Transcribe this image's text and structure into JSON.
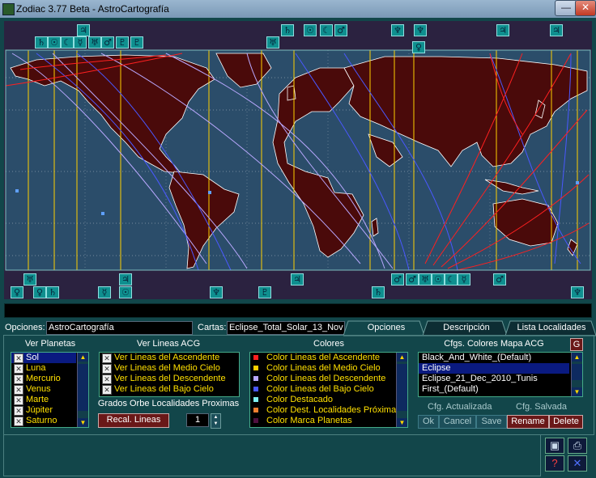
{
  "window": {
    "title": "Zodiac 3.77 Beta - AstroCartografía",
    "minimize_label": "—",
    "close_label": "✕"
  },
  "colors": {
    "asc": "#ff2020",
    "mc": "#ffd000",
    "desc": "#b9a8ff",
    "ic": "#4a58ff",
    "land": "#4a0a0a",
    "sea": "#2b4d6a"
  },
  "top_glyphs": [
    {
      "g": "♃",
      "icon": "jupiter-glyph-icon"
    },
    {
      "g": "♄",
      "icon": "saturn-glyph-icon"
    },
    {
      "g": "☉",
      "icon": "sun-glyph-icon"
    },
    {
      "g": "☾",
      "icon": "moon-glyph-icon"
    },
    {
      "g": "☿",
      "icon": "mercury-glyph-icon"
    },
    {
      "g": "♅",
      "icon": "uranus-glyph-icon"
    },
    {
      "g": "♂",
      "icon": "mars-glyph-icon"
    },
    {
      "g": "♇",
      "icon": "pluto-glyph-icon"
    },
    {
      "g": "♇",
      "icon": "pluto-glyph-icon"
    },
    {
      "g": "♅",
      "icon": "uranus-glyph-icon"
    },
    {
      "g": "♀",
      "icon": "venus-glyph-icon"
    },
    {
      "g": "♄",
      "icon": "saturn-glyph-icon"
    },
    {
      "g": "☉",
      "icon": "sun-glyph-icon"
    },
    {
      "g": "☾",
      "icon": "moon-glyph-icon"
    },
    {
      "g": "♂",
      "icon": "mars-glyph-icon"
    },
    {
      "g": "♆",
      "icon": "neptune-glyph-icon"
    },
    {
      "g": "♆",
      "icon": "neptune-glyph-icon"
    },
    {
      "g": "♃",
      "icon": "jupiter-glyph-icon"
    }
  ],
  "bottom_glyphs": [
    {
      "g": "♅",
      "icon": "uranus-glyph-icon"
    },
    {
      "g": "♃",
      "icon": "jupiter-glyph-icon"
    },
    {
      "g": "♃",
      "icon": "jupiter-glyph-icon"
    },
    {
      "g": "♀",
      "icon": "venus-glyph-icon"
    },
    {
      "g": "♀",
      "icon": "venus-glyph-icon"
    },
    {
      "g": "♄",
      "icon": "saturn-glyph-icon"
    },
    {
      "g": "☿",
      "icon": "mercury-glyph-icon"
    },
    {
      "g": "☉",
      "icon": "sun-glyph-icon"
    },
    {
      "g": "♂",
      "icon": "mars-glyph-icon"
    },
    {
      "g": "♂",
      "icon": "mars-glyph-icon"
    },
    {
      "g": "♅",
      "icon": "uranus-glyph-icon"
    },
    {
      "g": "☉",
      "icon": "sun-glyph-icon"
    },
    {
      "g": "☾",
      "icon": "moon-glyph-icon"
    },
    {
      "g": "☿",
      "icon": "mercury-glyph-icon"
    },
    {
      "g": "♂",
      "icon": "mars-glyph-icon"
    },
    {
      "g": "♆",
      "icon": "neptune-glyph-icon"
    },
    {
      "g": "♇",
      "icon": "pluto-glyph-icon"
    },
    {
      "g": "♄",
      "icon": "saturn-glyph-icon"
    },
    {
      "g": "♆",
      "icon": "neptune-glyph-icon"
    },
    {
      "g": "♃",
      "icon": "jupiter-glyph-icon"
    },
    {
      "g": "♀",
      "icon": "venus-glyph-icon"
    }
  ],
  "fields": {
    "opciones_label": "Opciones:",
    "opciones_value": "AstroCartografía",
    "cartas_label": "Cartas:",
    "cartas_value": "Eclipse_Total_Solar_13_Nov"
  },
  "tabs": [
    {
      "label": "Opciones",
      "active": true
    },
    {
      "label": "Descripción",
      "active": false
    },
    {
      "label": "Lista Localidades",
      "active": false
    }
  ],
  "ver_planetas": {
    "title": "Ver Planetas",
    "items": [
      "Sol",
      "Luna",
      "Mercurio",
      "Venus",
      "Marte",
      "Júpiter",
      "Saturno"
    ],
    "selected": "Sol"
  },
  "ver_lineas": {
    "title": "Ver Lineas ACG",
    "items": [
      "Ver Lineas del Ascendente",
      "Ver Lineas del Medio Cielo",
      "Ver Lineas del Descendente",
      "Ver Lineas del Bajo Cielo"
    ]
  },
  "orbe": {
    "title": "Grados Orbe Localidades Proximas",
    "recalc_label": "Recal. Lineas",
    "value": "1"
  },
  "colores": {
    "title": "Colores",
    "items": [
      {
        "label": "Color Lineas del Ascendente",
        "color": "#ff2020"
      },
      {
        "label": "Color Lineas del Medio Cielo",
        "color": "#ffd000"
      },
      {
        "label": "Color Lineas del Descendente",
        "color": "#b9a8ff"
      },
      {
        "label": "Color Lineas del Bajo Cielo",
        "color": "#4a58ff"
      },
      {
        "label": "Color Destacado",
        "color": "#7ef0f0"
      },
      {
        "label": "Color Dest. Localidades Próximas",
        "color": "#f08030"
      },
      {
        "label": "Color Marca Planetas",
        "color": "#501040"
      }
    ]
  },
  "cfgs": {
    "title": "Cfgs. Colores Mapa ACG",
    "g_label": "G",
    "items": [
      "Black_And_White_(Default)",
      "Eclipse",
      "Eclipse_21_Dec_2010_Tunis",
      "First_(Default)"
    ],
    "selected": "Eclipse",
    "status_updated": "Cfg. Actualizada",
    "status_saved": "Cfg. Salvada",
    "buttons": [
      {
        "label": "Ok",
        "enabled": false
      },
      {
        "label": "Cancel",
        "enabled": false
      },
      {
        "label": "Save",
        "enabled": false
      },
      {
        "label": "Rename",
        "enabled": true
      },
      {
        "label": "Delete",
        "enabled": true
      }
    ]
  }
}
